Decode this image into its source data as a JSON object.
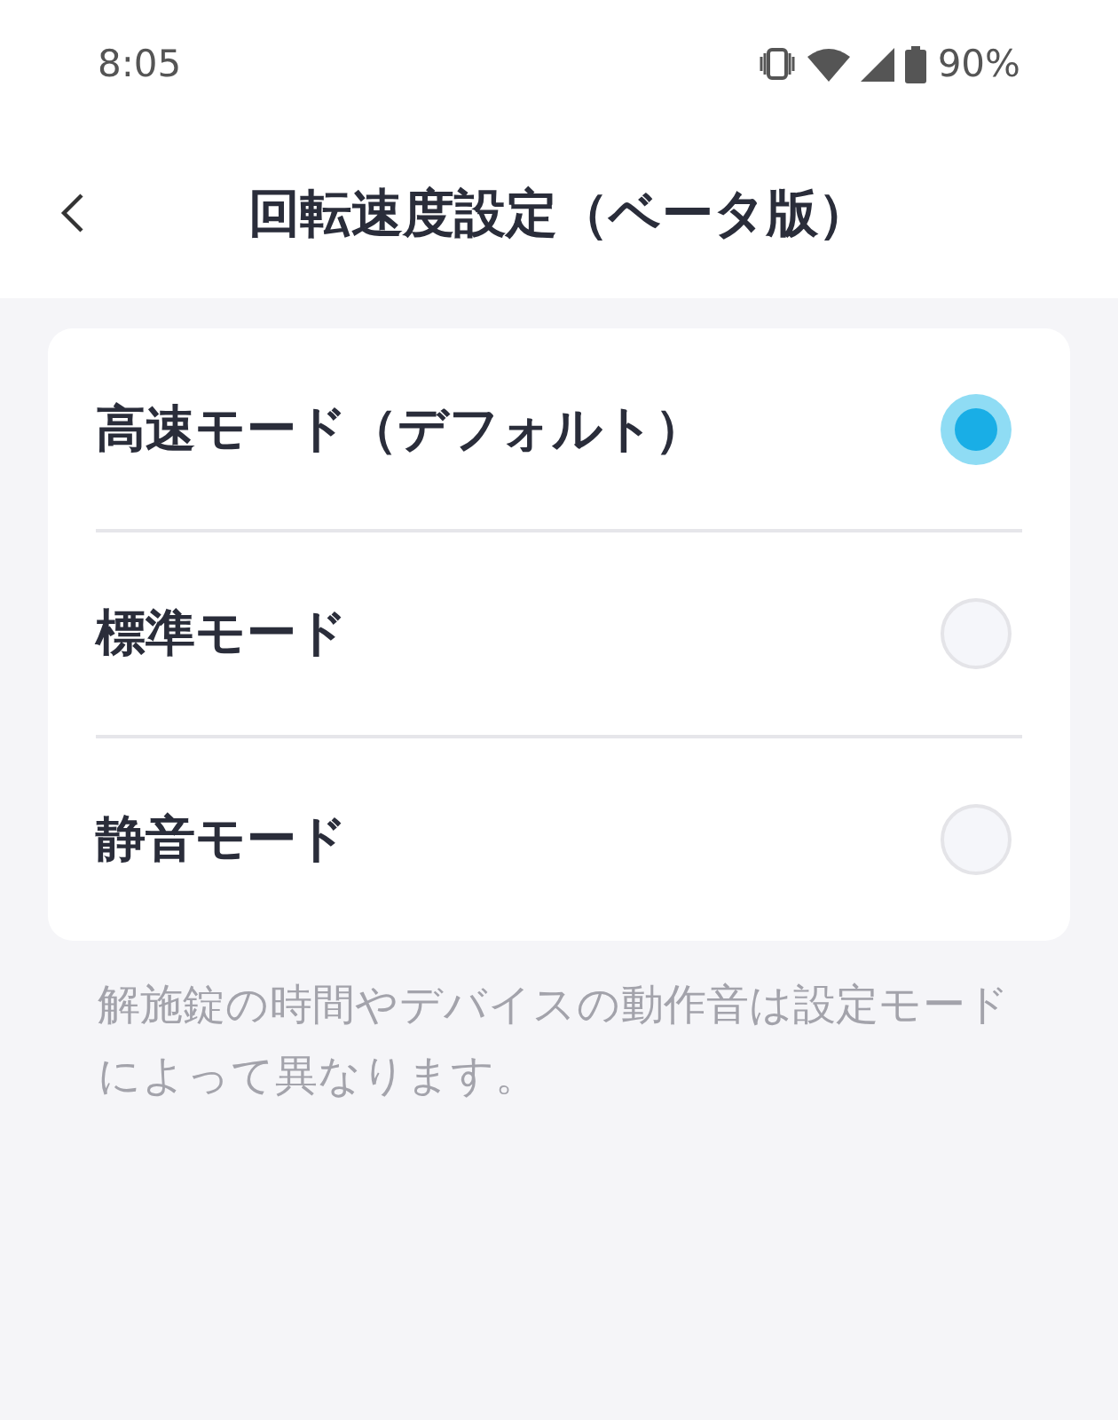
{
  "status_bar": {
    "time": "8:05",
    "battery": "90%"
  },
  "header": {
    "title": "回転速度設定（ベータ版）"
  },
  "options": [
    {
      "label": "高速モード（デフォルト）",
      "selected": true
    },
    {
      "label": "標準モード",
      "selected": false
    },
    {
      "label": "静音モード",
      "selected": false
    }
  ],
  "note": "解施錠の時間やデバイスの動作音は設定モードによって異なります。"
}
